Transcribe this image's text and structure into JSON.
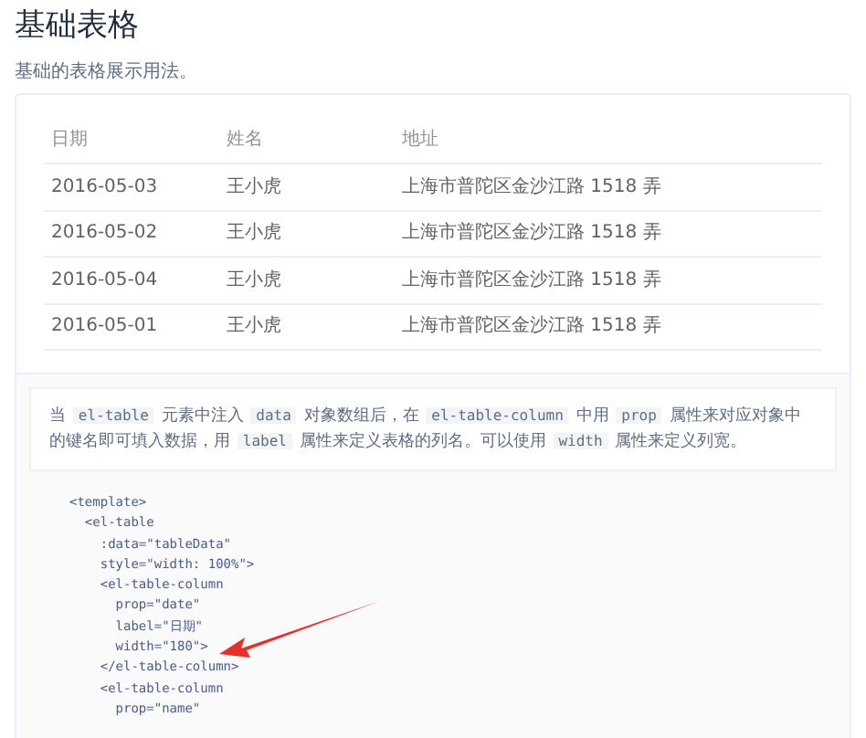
{
  "title": "基础表格",
  "subtitle": "基础的表格展示用法。",
  "table": {
    "columns": [
      "日期",
      "姓名",
      "地址"
    ],
    "rows": [
      [
        "2016-05-03",
        "王小虎",
        "上海市普陀区金沙江路 1518 弄"
      ],
      [
        "2016-05-02",
        "王小虎",
        "上海市普陀区金沙江路 1518 弄"
      ],
      [
        "2016-05-04",
        "王小虎",
        "上海市普陀区金沙江路 1518 弄"
      ],
      [
        "2016-05-01",
        "王小虎",
        "上海市普陀区金沙江路 1518 弄"
      ]
    ]
  },
  "description": [
    {
      "kind": "text",
      "text": "当 "
    },
    {
      "kind": "code",
      "text": "el-table"
    },
    {
      "kind": "text",
      "text": " 元素中注入 "
    },
    {
      "kind": "code",
      "text": "data"
    },
    {
      "kind": "text",
      "text": " 对象数组后，在 "
    },
    {
      "kind": "code",
      "text": "el-table-column"
    },
    {
      "kind": "text",
      "text": " 中用 "
    },
    {
      "kind": "code",
      "text": "prop"
    },
    {
      "kind": "text",
      "text": " 属性来对应对象中的键名即可填入数据，用 "
    },
    {
      "kind": "code",
      "text": "label"
    },
    {
      "kind": "text",
      "text": " 属性来定义表格的列名。可以使用 "
    },
    {
      "kind": "code",
      "text": "width"
    },
    {
      "kind": "text",
      "text": " 属性来定义列宽。"
    }
  ],
  "code_lines": [
    "<template>",
    "  <el-table",
    "    :data=\"tableData\"",
    "    style=\"width: 100%\">",
    "    <el-table-column",
    "      prop=\"date\"",
    "      label=\"日期\"",
    "      width=\"180\">",
    "    </el-table-column>",
    "    <el-table-column",
    "      prop=\"name\""
  ]
}
